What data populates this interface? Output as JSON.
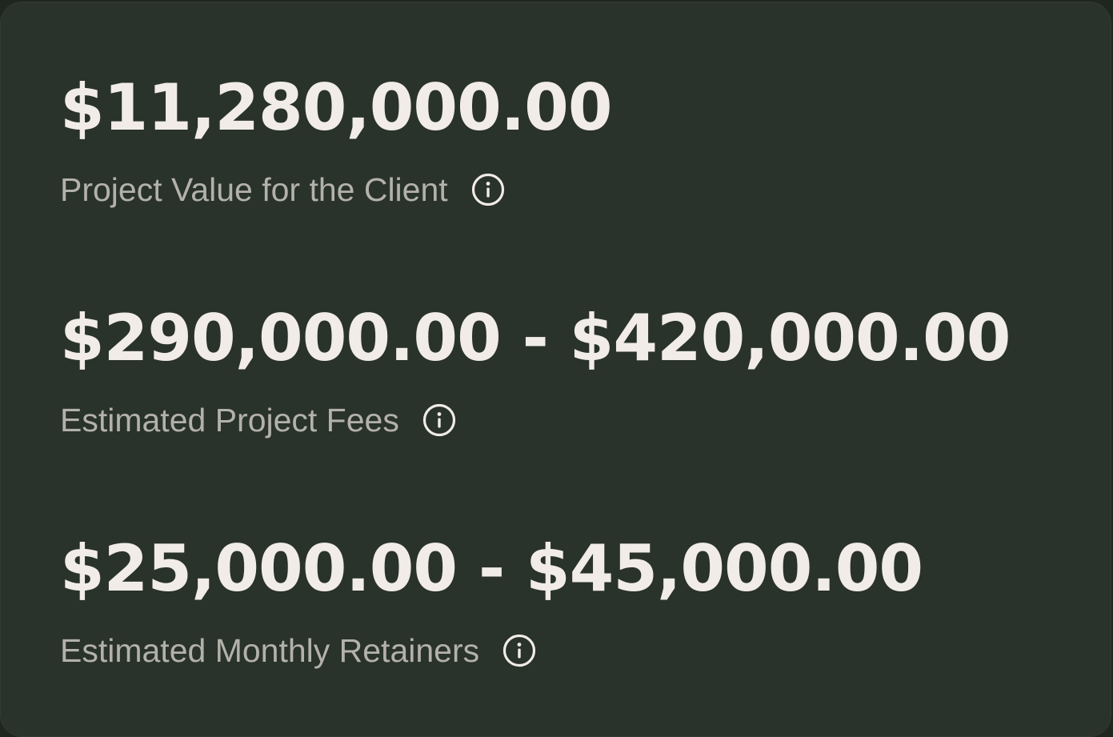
{
  "metrics": [
    {
      "value": "$11,280,000.00",
      "label": "Project Value for the Client",
      "icon": "info-icon"
    },
    {
      "value": "$290,000.00 - $420,000.00",
      "label": "Estimated Project Fees",
      "icon": "info-icon"
    },
    {
      "value": "$25,000.00 - $45,000.00",
      "label": "Estimated Monthly Retainers",
      "icon": "info-icon"
    }
  ],
  "colors": {
    "card_background": "#29322b",
    "value_text": "#f1ece8",
    "label_text": "#b3b1ab",
    "icon_stroke": "#f1ece8"
  }
}
